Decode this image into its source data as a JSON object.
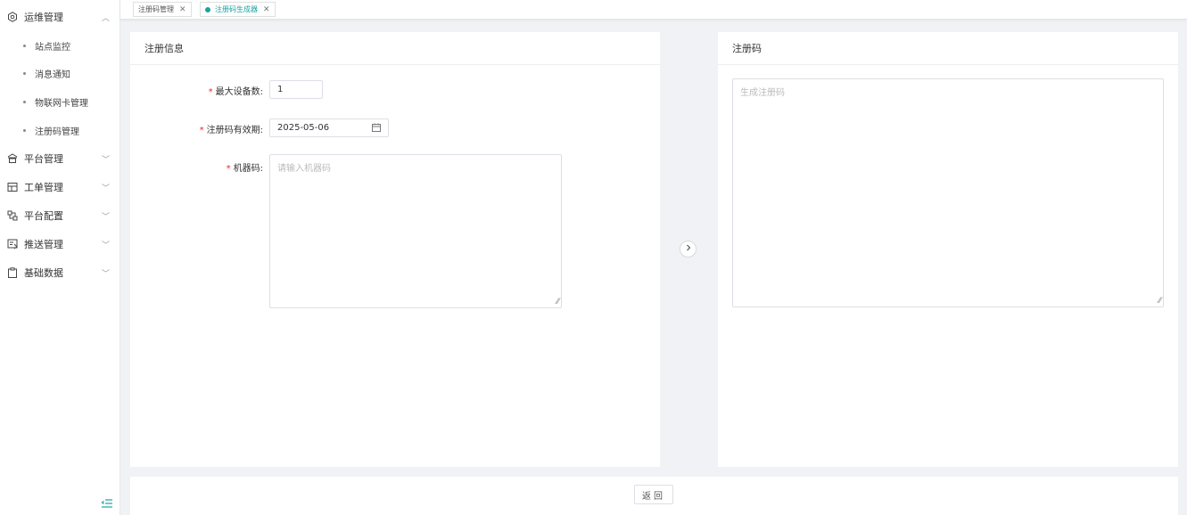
{
  "sidebar": {
    "groups": [
      {
        "label": "运维管理",
        "icon": "settings-icon",
        "expanded": true,
        "children": [
          "站点监控",
          "消息通知",
          "物联网卡管理",
          "注册码管理"
        ]
      },
      {
        "label": "平台管理",
        "icon": "platform-icon",
        "expanded": false
      },
      {
        "label": "工单管理",
        "icon": "workorder-icon",
        "expanded": false
      },
      {
        "label": "平台配置",
        "icon": "config-icon",
        "expanded": false
      },
      {
        "label": "推送管理",
        "icon": "push-icon",
        "expanded": false
      },
      {
        "label": "基础数据",
        "icon": "clipboard-icon",
        "expanded": false
      }
    ],
    "collapse_icon": "menu-collapse-icon"
  },
  "tabs": [
    {
      "label": "注册码管理",
      "active": false
    },
    {
      "label": "注册码生成器",
      "active": true
    }
  ],
  "left_panel": {
    "title": "注册信息",
    "fields": {
      "max_devices": {
        "label": "最大设备数",
        "value": "1"
      },
      "expiry": {
        "label": "注册码有效期",
        "value": "2025-05-06"
      },
      "machine_code": {
        "label": "机器码",
        "placeholder": "请输入机器码"
      }
    }
  },
  "right_panel": {
    "title": "注册码",
    "output": {
      "placeholder": "生成注册码"
    }
  },
  "footer": {
    "back_label": "返回"
  },
  "colors": {
    "accent": "#1ea2a0",
    "required": "#f5222d"
  }
}
